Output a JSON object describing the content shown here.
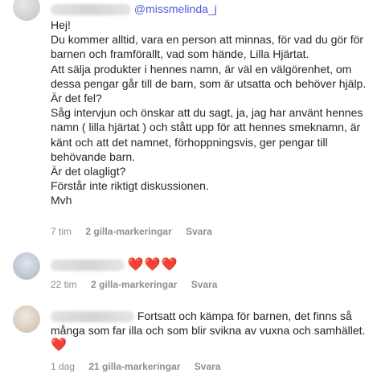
{
  "comments": [
    {
      "mention": "@missmelinda_j",
      "body": "Hej!\nDu kommer alltid, vara en person att minnas, för vad du gör för barnen och framförallt, vad som hände, Lilla Hjärtat.\nAtt sälja produkter i hennes namn, är väl en välgörenhet, om dessa pengar går till de barn, som är utsatta och behöver hjälp.\nÄr det fel?\nSåg intervjun och önskar att du sagt, ja, jag har använt hennes namn ( lilla hjärtat ) och stått upp för att hennes smeknamn, är känt och att det namnet, förhoppningsvis, ger pengar till behövande barn.\nÄr det olagligt?\nFörstår inte riktigt diskussionen.\nMvh",
      "time": "7 tim",
      "likes": "2 gilla-markeringar",
      "reply": "Svara"
    },
    {
      "hearts": "❤️❤️❤️",
      "time": "22 tim",
      "likes": "2 gilla-markeringar",
      "reply": "Svara"
    },
    {
      "body_end": "Fortsatt och kämpa för barnen, det finns så många som far illa och som blir svikna av vuxna och samhället.",
      "heart": "❤️",
      "time": "1 dag",
      "likes": "21 gilla-markeringar",
      "reply": "Svara"
    }
  ]
}
